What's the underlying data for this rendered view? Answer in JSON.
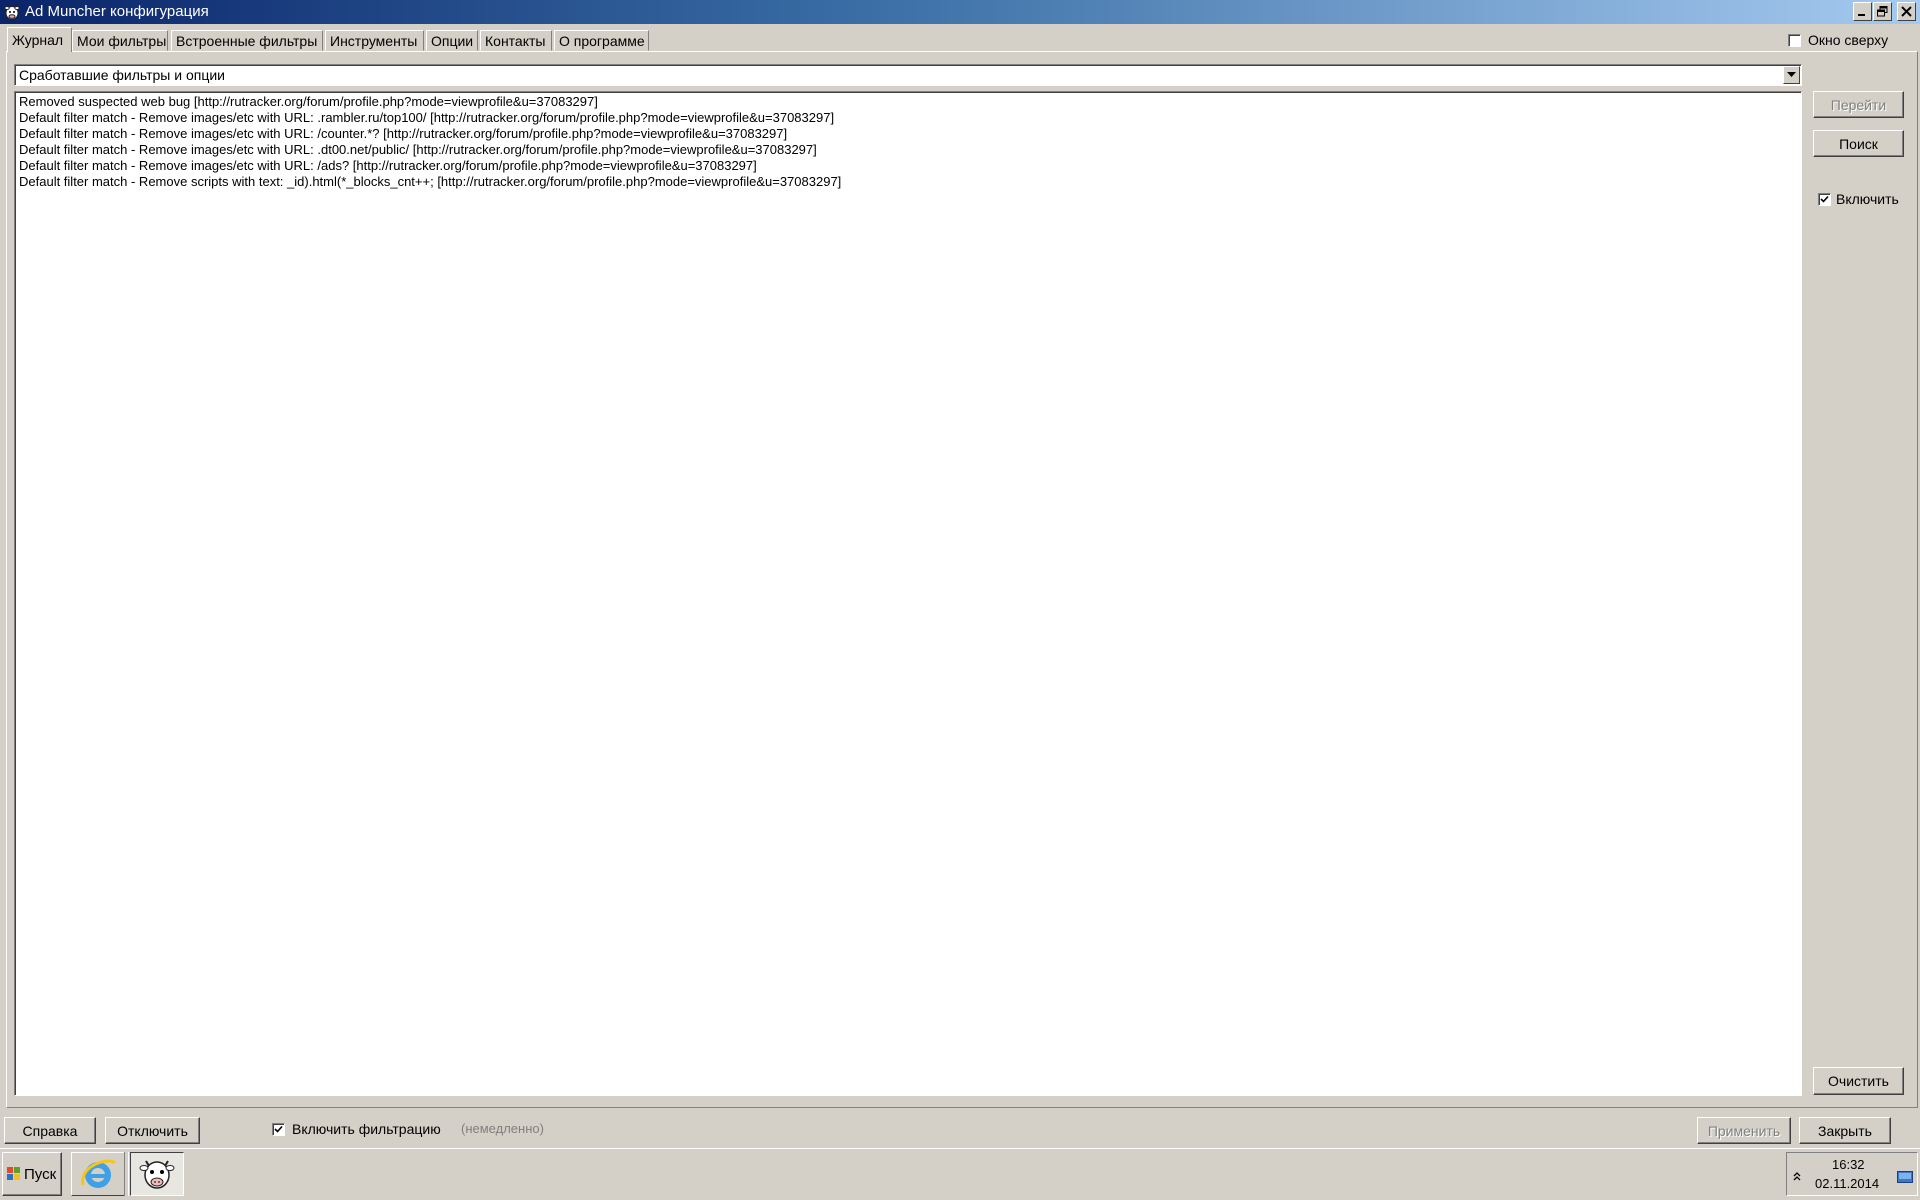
{
  "window": {
    "title": "Ad Muncher конфигурация",
    "icons": {
      "app": "ad-muncher-cow-icon",
      "minimize": "minimize-icon",
      "maximize": "restore-icon",
      "close": "close-icon"
    }
  },
  "tabs": [
    {
      "label": "Журнал",
      "active": true
    },
    {
      "label": "Мои фильтры",
      "active": false
    },
    {
      "label": "Встроенные фильтры",
      "active": false
    },
    {
      "label": "Инструменты",
      "active": false
    },
    {
      "label": "Опции",
      "active": false
    },
    {
      "label": "Контакты",
      "active": false
    },
    {
      "label": "О программе",
      "active": false
    }
  ],
  "always_on_top": {
    "label": "Окно сверху",
    "checked": false
  },
  "log_filter": {
    "selected": "Сработавшие фильтры и опции"
  },
  "log_lines": [
    "Removed suspected web bug [http://rutracker.org/forum/profile.php?mode=viewprofile&u=37083297]",
    "Default filter match - Remove images/etc with URL: .rambler.ru/top100/ [http://rutracker.org/forum/profile.php?mode=viewprofile&u=37083297]",
    "Default filter match - Remove images/etc with URL: /counter.*? [http://rutracker.org/forum/profile.php?mode=viewprofile&u=37083297]",
    "Default filter match - Remove images/etc with URL: .dt00.net/public/ [http://rutracker.org/forum/profile.php?mode=viewprofile&u=37083297]",
    "Default filter match - Remove images/etc with URL: /ads? [http://rutracker.org/forum/profile.php?mode=viewprofile&u=37083297]",
    "Default filter match - Remove scripts with text: _id).html(*_blocks_cnt++; [http://rutracker.org/forum/profile.php?mode=viewprofile&u=37083297]"
  ],
  "side": {
    "goto_label": "Перейти",
    "search_label": "Поиск",
    "enable": {
      "label": "Включить",
      "checked": true
    },
    "clear_label": "Очистить"
  },
  "bottom": {
    "help_label": "Справка",
    "disable_label": "Отключить",
    "filtering": {
      "label": "Включить фильтрацию",
      "checked": true
    },
    "immediate_note": "(немедленно)",
    "apply_label": "Применить",
    "close_label": "Закрыть"
  },
  "taskbar": {
    "start_label": "Пуск",
    "apps": [
      "internet-explorer-icon",
      "ad-muncher-cow-icon"
    ],
    "clock_time": "16:32",
    "clock_date": "02.11.2014"
  },
  "colors": {
    "face": "#d4d0c8",
    "title_start": "#0a246a",
    "title_end": "#a6caf0"
  }
}
